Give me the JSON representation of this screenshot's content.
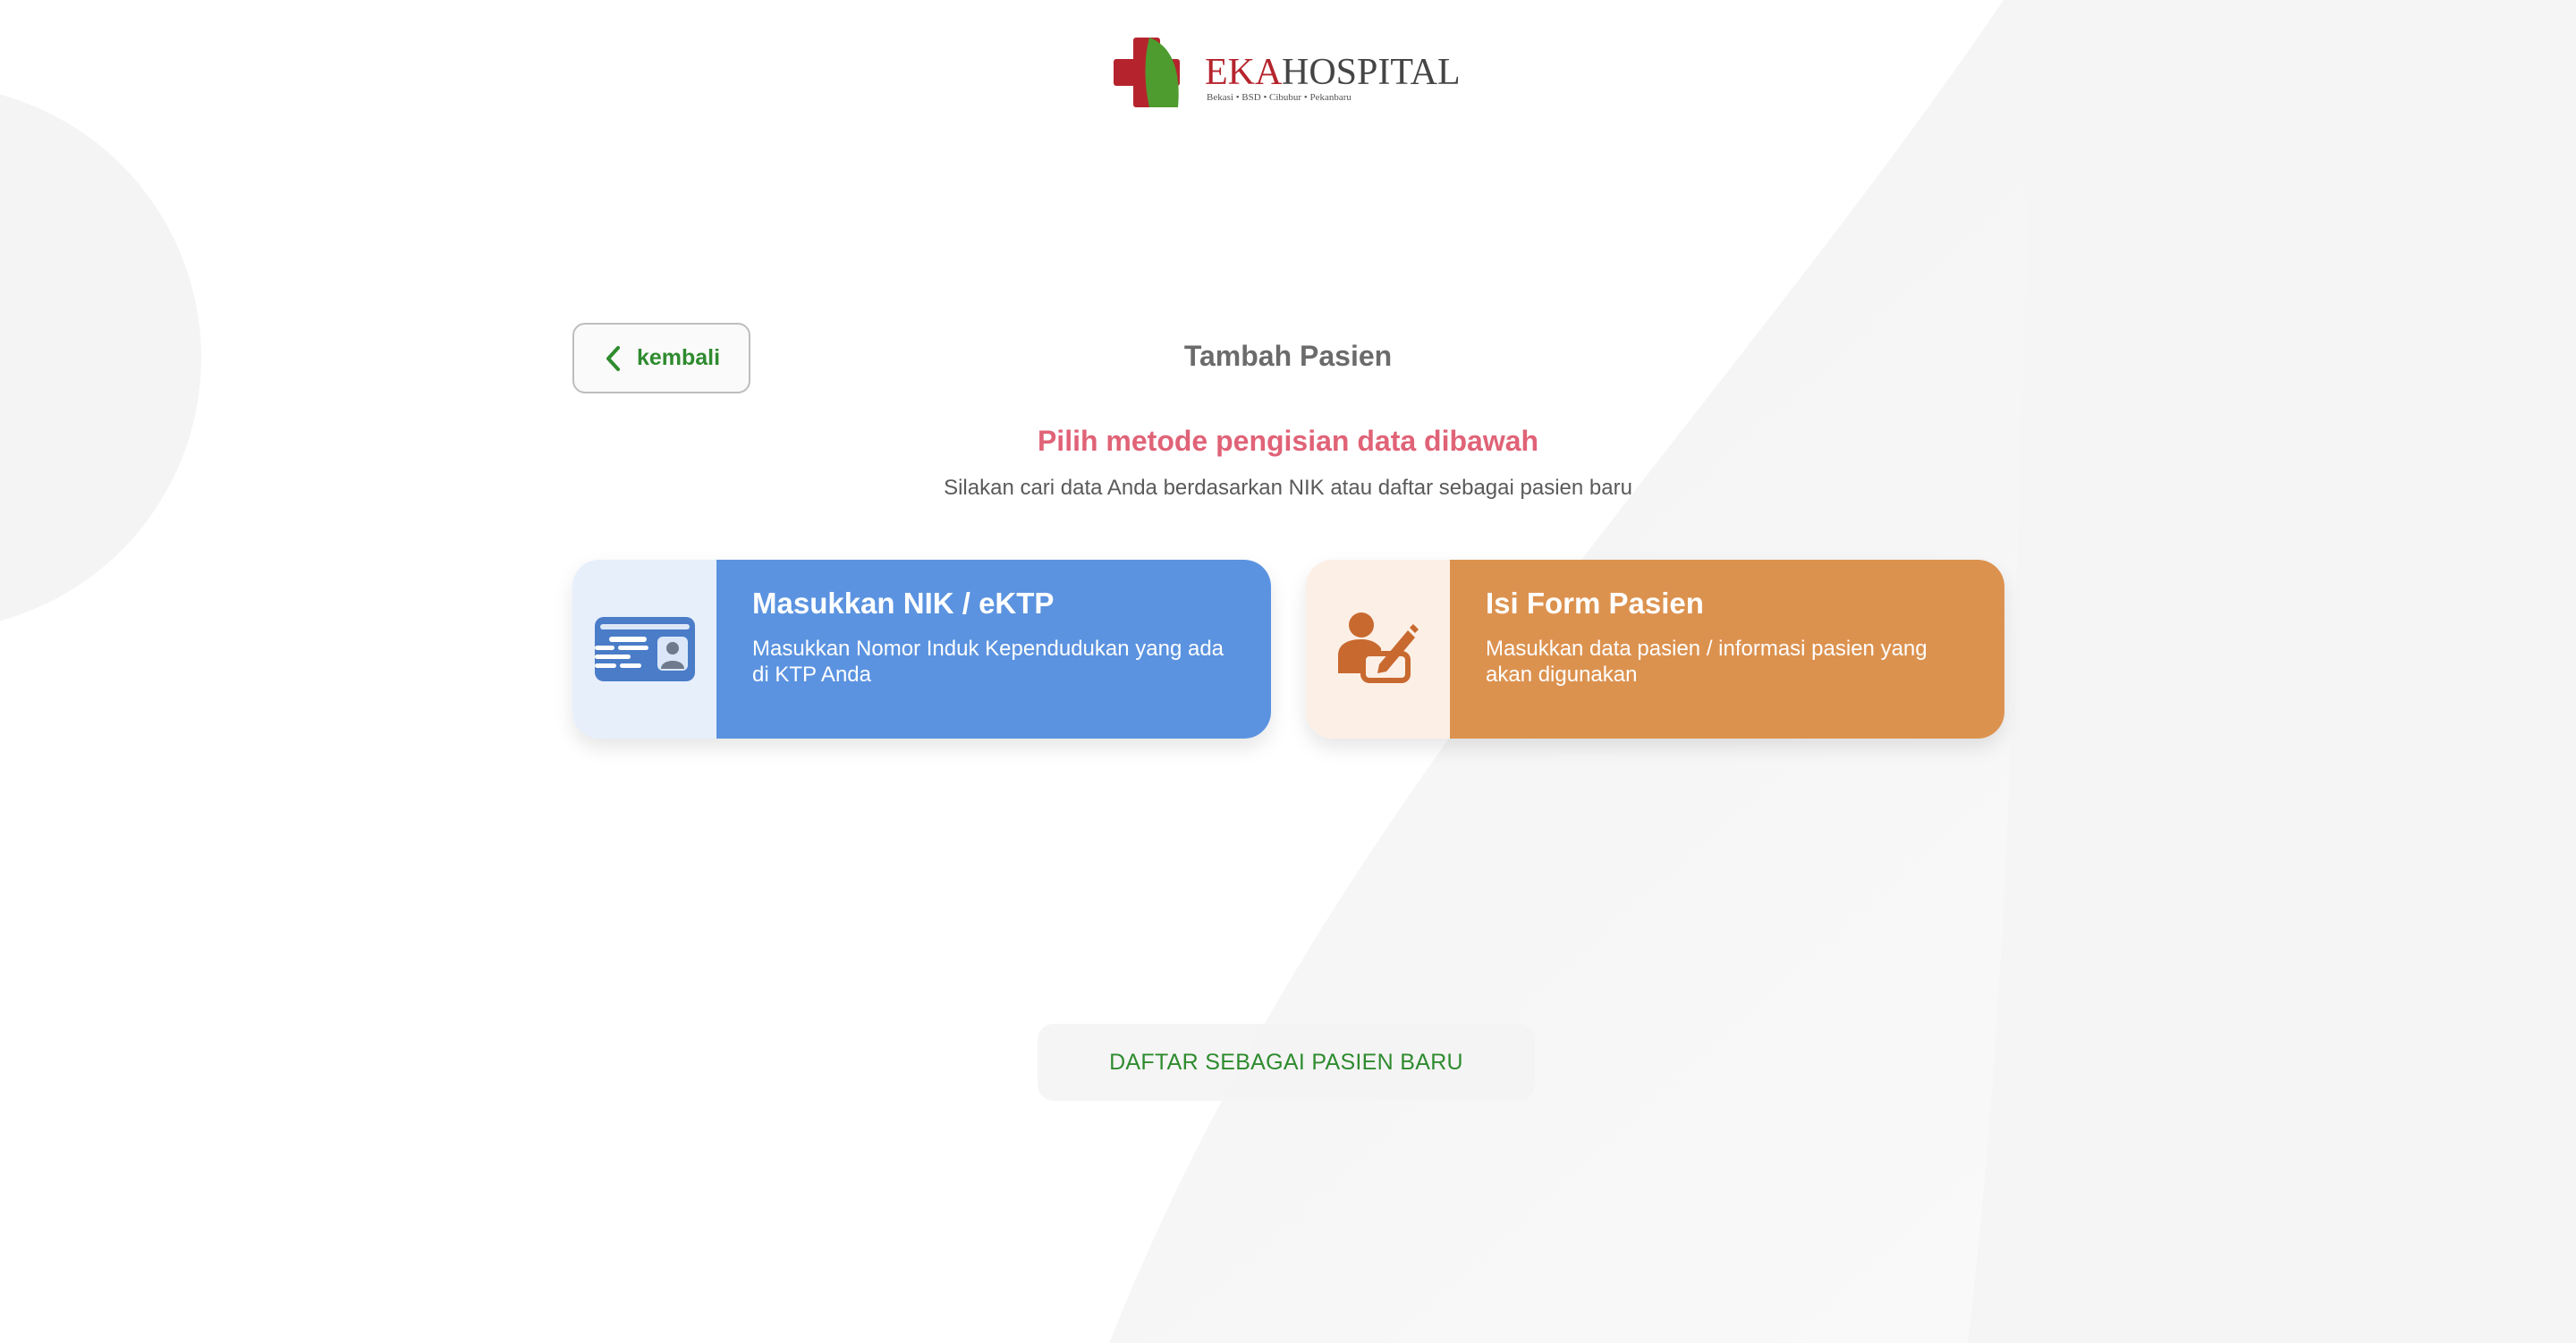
{
  "brand": {
    "name_part1": "EKA",
    "name_part2": "HOSPITAL",
    "locations": "Bekasi • BSD • Cibubur • Pekanbaru",
    "colors": {
      "red": "#b5242d",
      "green": "#4e9b2f"
    }
  },
  "header": {
    "back_label": "kembali",
    "title": "Tambah Pasien"
  },
  "intro": {
    "heading": "Pilih metode pengisian data dibawah",
    "subheading": "Silakan cari data Anda berdasarkan NIK atau daftar sebagai pasien baru"
  },
  "options": [
    {
      "icon": "id-card-icon",
      "title": "Masukkan NIK / eKTP",
      "description": "Masukkan Nomor Induk Kependudukan yang ada di KTP Anda",
      "color": "#5b93e0"
    },
    {
      "icon": "user-edit-icon",
      "title": "Isi Form Pasien",
      "description": "Masukkan data pasien / informasi pasien yang akan digunakan",
      "color": "#dc924f"
    }
  ],
  "register": {
    "label": "DAFTAR SEBAGAI PASIEN BARU"
  }
}
